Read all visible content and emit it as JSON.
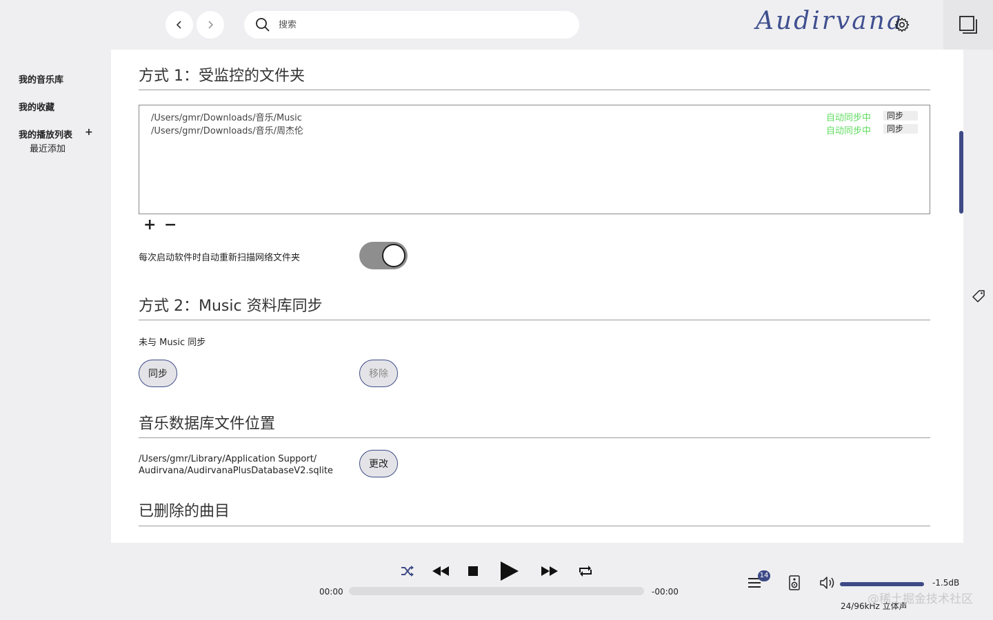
{
  "header": {
    "back_icon": "chevron-left-icon",
    "forward_icon": "chevron-right-icon",
    "search_placeholder": "搜索",
    "logo_text": "Audirvana",
    "settings_icon": "gear-icon",
    "window_icon": "window-icon"
  },
  "sidebar": {
    "items": [
      {
        "label": "我的音乐库"
      },
      {
        "label": "我的收藏"
      },
      {
        "label": "我的播放列表"
      }
    ],
    "playlist_add": "+",
    "playlist_children": [
      {
        "label": "最近添加"
      }
    ]
  },
  "main": {
    "section1": {
      "title": "方式 1：受监控的文件夹",
      "folders": [
        {
          "path": "/Users/gmr/Downloads/音乐/Music",
          "status": "自动同步中",
          "action": "同步"
        },
        {
          "path": "/Users/gmr/Downloads/音乐/周杰伦",
          "status": "自动同步中",
          "action": "同步"
        }
      ],
      "add": "+",
      "remove": "−",
      "toggle_label": "每次启动软件时自动重新扫描网络文件夹",
      "toggle_on": true
    },
    "section2": {
      "title": "方式 2：Music 资料库同步",
      "status": "未与 Music 同步",
      "sync_button": "同步",
      "remove_button": "移除"
    },
    "section3": {
      "title": "音乐数据库文件位置",
      "path_line1": "/Users/gmr/Library/Application Support/",
      "path_line2": "Audirvana/AudirvanaPlusDatabaseV2.sqlite",
      "change_button": "更改"
    },
    "section4": {
      "title": "已删除的曲目"
    }
  },
  "player": {
    "elapsed": "00:00",
    "remaining": "-00:00",
    "progress": 0,
    "queue_count": "14",
    "volume_db": "-1.5dB",
    "format": "24/96kHz 立体声",
    "watermark": "@稀土掘金技术社区"
  },
  "colors": {
    "accent": "#3e4a86",
    "sync_status": "#5fdc5f",
    "toggle_on": "#8e8e8e"
  }
}
